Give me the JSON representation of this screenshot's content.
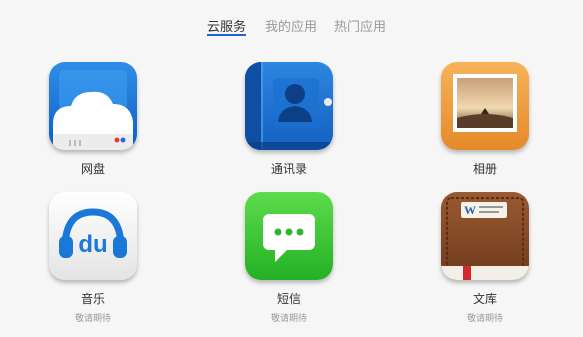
{
  "tabs": [
    {
      "label": "云服务"
    },
    {
      "label": "我的应用"
    },
    {
      "label": "热门应用"
    }
  ],
  "accent_color": "#1a64d8",
  "apps": [
    {
      "label": "网盘",
      "icon": "cloud-drive-icon"
    },
    {
      "label": "通讯录",
      "icon": "contacts-book-icon"
    },
    {
      "label": "相册",
      "icon": "photo-album-icon"
    },
    {
      "label": "音乐",
      "icon": "music-headphones-icon",
      "status": "敬请期待"
    },
    {
      "label": "短信",
      "icon": "sms-bubble-icon",
      "status": "敬请期待"
    },
    {
      "label": "文库",
      "icon": "library-book-icon",
      "status": "敬请期待"
    }
  ]
}
